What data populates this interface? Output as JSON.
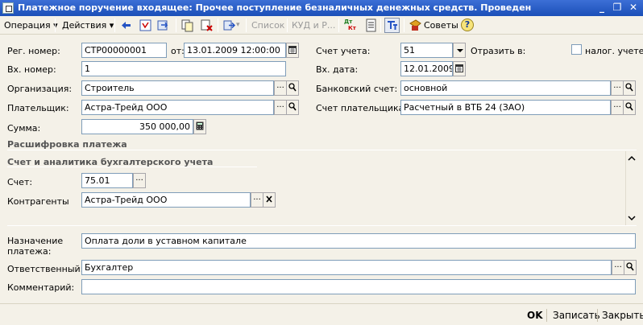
{
  "window": {
    "title": "Платежное поручение входящее: Прочее поступление безналичных денежных средств. Проведен",
    "btn_min": "_",
    "btn_max": "❐",
    "btn_close": "✕"
  },
  "toolbar": {
    "operation": "Операция",
    "actions": "Действия",
    "list": "Список",
    "kud": "КУД и Р...",
    "advice": "Советы",
    "help": "?",
    "dropdown_glyph": "▾",
    "dtkt_top": "Дт",
    "dtkt_bottom": "Кт"
  },
  "form": {
    "reg_number_label": "Рег. номер:",
    "reg_number": "СТР00000001",
    "from_label": "от:",
    "date": "13.01.2009 12:00:00",
    "in_number_label": "Вх. номер:",
    "in_number": "1",
    "org_label": "Организация:",
    "org": "Строитель",
    "payer_label": "Плательщик:",
    "payer": "Астра-Трейд ООО",
    "sum_label": "Сумма:",
    "sum": "350 000,00",
    "account_label": "Счет учета:",
    "account": "51",
    "reflect_label": "Отразить в:",
    "tax_label": "налог. учете",
    "tax_checked": false,
    "in_date_label": "Вх. дата:",
    "in_date": "12.01.2009",
    "bank_label": "Банковский счет:",
    "bank": "основной",
    "payer_account_label": "Счет плательщика:",
    "payer_account": "Расчетный в ВТБ 24 (ЗАО)"
  },
  "breakdown": {
    "title": "Расшифровка платежа",
    "subtitle": "Счет и аналитика бухгалтерского учета",
    "account_label": "Счет:",
    "account": "75.01",
    "contractors_label": "Контрагенты",
    "contractor": "Астра-Трейд ООО"
  },
  "purpose": {
    "label_line1": "Назначение",
    "label_line2": "платежа:",
    "value": "Оплата доли в уставном капитале",
    "responsible_label": "Ответственный:",
    "responsible": "Бухгалтер",
    "comment_label": "Комментарий:",
    "comment": ""
  },
  "buttons": {
    "ok": "OK",
    "save": "Записать",
    "close": "Закрыть"
  },
  "icons": {
    "calendar": "calendar-icon",
    "search": "search-icon",
    "calculator": "calculator-icon",
    "clear": "clear-icon"
  }
}
